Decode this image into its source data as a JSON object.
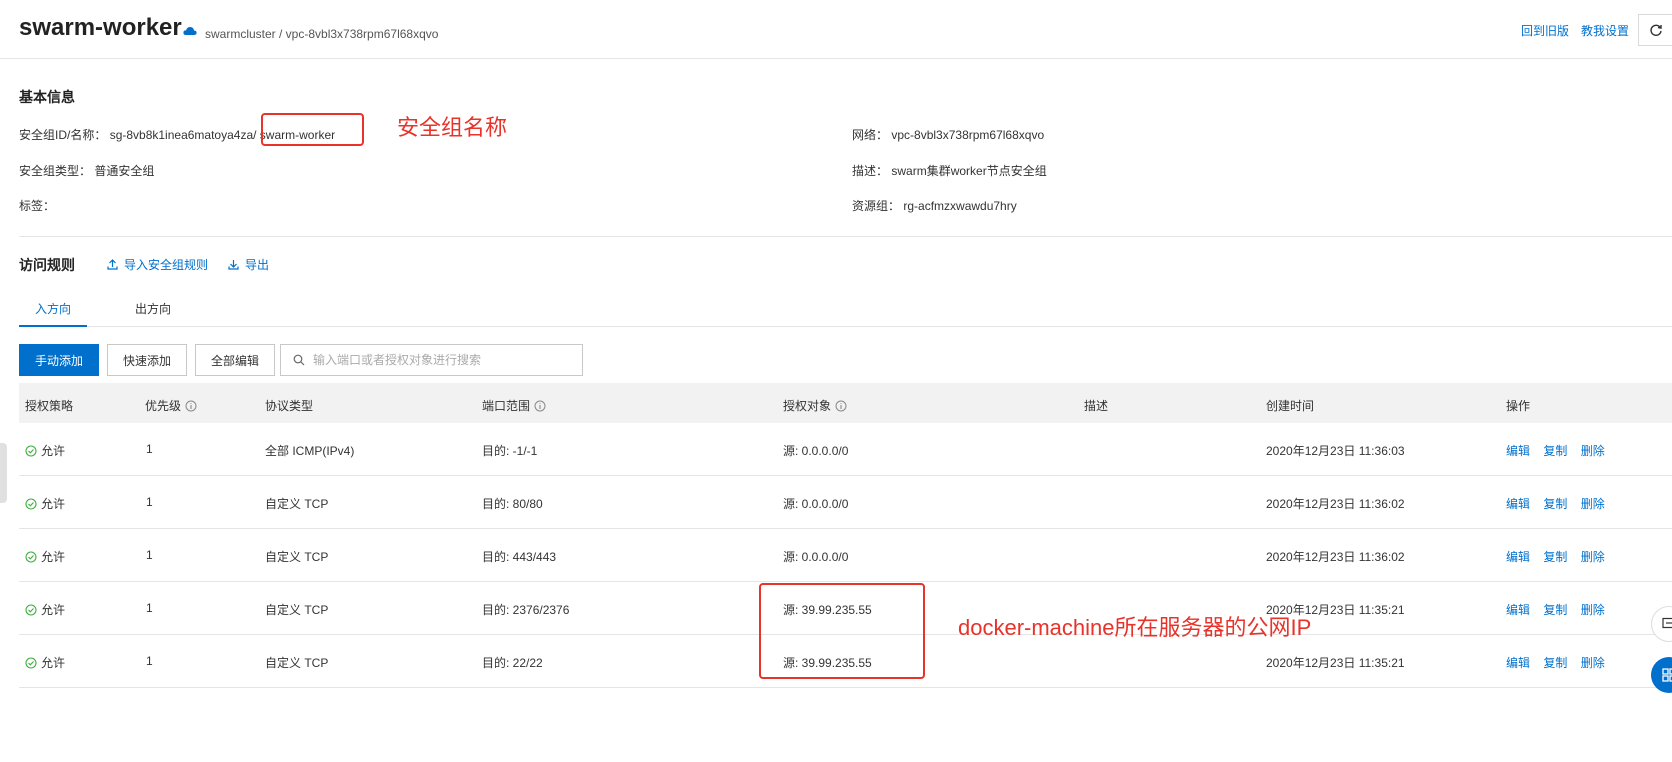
{
  "header": {
    "title": "swarm-worker",
    "breadcrumb": "swarmcluster / vpc-8vbl3x738rpm67l68xqvo",
    "back_to_old": "回到旧版",
    "teach_settings": "教我设置"
  },
  "basic_info": {
    "title": "基本信息",
    "id_name_label": "安全组ID/名称：",
    "id_value": "sg-8vb8k1inea6matoya4za/",
    "name_value": "swarm-worker",
    "type_label": "安全组类型：",
    "type_value": "普通安全组",
    "tags_label": "标签：",
    "network_label": "网络：",
    "network_value": "vpc-8vbl3x738rpm67l68xqvo",
    "desc_label": "描述：",
    "desc_value": "swarm集群worker节点安全组",
    "rg_label": "资源组：",
    "rg_value": "rg-acfmzxwawdu7hry"
  },
  "annotations": {
    "name_note": "安全组名称",
    "ip_note": "docker-machine所在服务器的公网IP"
  },
  "rules": {
    "title": "访问规则",
    "import_label": "导入安全组规则",
    "export_label": "导出",
    "tabs": [
      "入方向",
      "出方向"
    ],
    "buttons": {
      "manual_add": "手动添加",
      "quick_add": "快速添加",
      "edit_all": "全部编辑"
    },
    "search_placeholder": "输入端口或者授权对象进行搜索",
    "columns": [
      "授权策略",
      "优先级",
      "协议类型",
      "端口范围",
      "授权对象",
      "描述",
      "创建时间",
      "操作"
    ],
    "ops": [
      "编辑",
      "复制",
      "删除"
    ],
    "rows": [
      {
        "policy": "允许",
        "priority": "1",
        "protocol": "全部 ICMP(IPv4)",
        "port": "目的: -1/-1",
        "source": "源: 0.0.0.0/0",
        "desc": "",
        "time": "2020年12月23日 11:36:03"
      },
      {
        "policy": "允许",
        "priority": "1",
        "protocol": "自定义 TCP",
        "port": "目的: 80/80",
        "source": "源: 0.0.0.0/0",
        "desc": "",
        "time": "2020年12月23日 11:36:02"
      },
      {
        "policy": "允许",
        "priority": "1",
        "protocol": "自定义 TCP",
        "port": "目的: 443/443",
        "source": "源: 0.0.0.0/0",
        "desc": "",
        "time": "2020年12月23日 11:36:02"
      },
      {
        "policy": "允许",
        "priority": "1",
        "protocol": "自定义 TCP",
        "port": "目的: 2376/2376",
        "source": "源: 39.99.235.55",
        "desc": "",
        "time": "2020年12月23日 11:35:21"
      },
      {
        "policy": "允许",
        "priority": "1",
        "protocol": "自定义 TCP",
        "port": "目的: 22/22",
        "source": "源: 39.99.235.55",
        "desc": "",
        "time": "2020年12月23日 11:35:21"
      }
    ]
  },
  "colors": {
    "accent": "#0070cc",
    "annotation": "#e8322a",
    "allow_green": "#3fae3f"
  }
}
